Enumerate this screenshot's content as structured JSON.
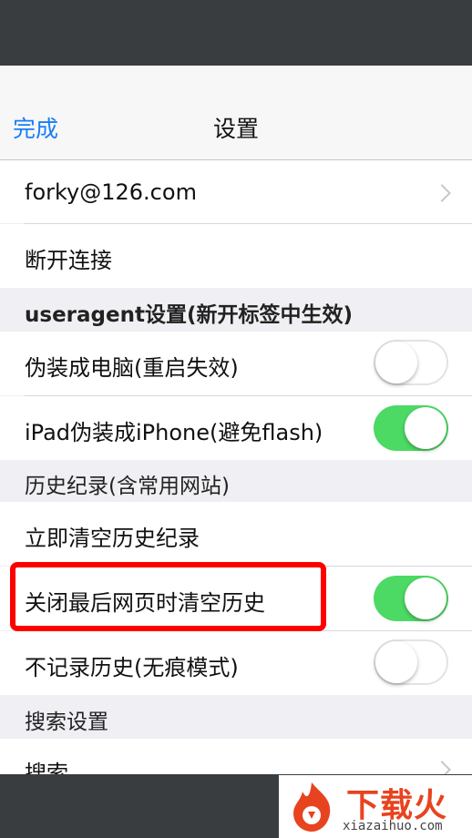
{
  "nav": {
    "done_label": "完成",
    "title": "设置"
  },
  "account": {
    "email": "forky@126.com",
    "disconnect_label": "断开连接"
  },
  "useragent": {
    "header": "useragent设置(新开标签中生效)",
    "items": [
      {
        "label": "伪装成电脑(重启失效)",
        "state": "off"
      },
      {
        "label": "iPad伪装成iPhone(避免flash)",
        "state": "on"
      }
    ]
  },
  "history": {
    "header": "历史纪录(含常用网站)",
    "clear_now_label": "立即清空历史纪录",
    "items": [
      {
        "label": "关闭最后网页时清空历史",
        "state": "on"
      },
      {
        "label": "不记录历史(无痕模式)",
        "state": "off"
      }
    ]
  },
  "search": {
    "header": "搜索设置",
    "item_label": "搜索"
  },
  "watermark": {
    "brand": "下载火",
    "site": "xiazaihuo.com"
  },
  "colors": {
    "accent": "#1a7ef5",
    "toggle_on": "#4cd964",
    "highlight": "#ff0000",
    "brand": "#e8431f"
  }
}
